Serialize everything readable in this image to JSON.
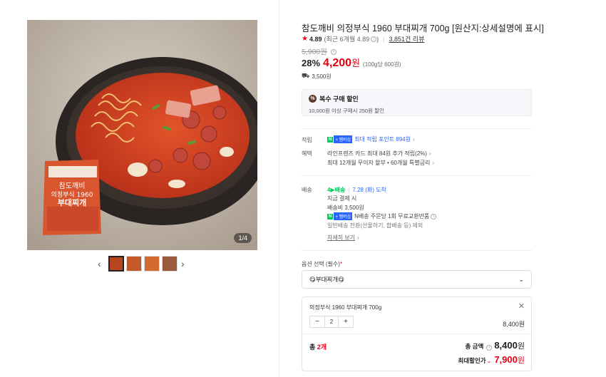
{
  "gallery": {
    "page_indicator": "1/4",
    "thumbnail_count": 4,
    "bag_text_line1": "참도깨비",
    "bag_text_line2": "의정부식 1960",
    "bag_text_line3": "부대찌개"
  },
  "product": {
    "title": "참도깨비 의정부식 1960 부대찌개 700g [원산지:상세설명에 표시]",
    "rating": "4.89",
    "rating_recent": "(최근 6개월 4.89",
    "rating_recent_close": ")",
    "review_link": "3,851건 리뷰",
    "original_price": "5,900원",
    "discount_rate": "28%",
    "price": "4,200",
    "price_unit": "원",
    "unit_price": "(100g당 600원)",
    "shipping_fee_top": "3,500원"
  },
  "coupon": {
    "icon": "%",
    "title": "복수 구매 할인",
    "desc": "10,000원 이상 구매시 250원 할인"
  },
  "benefits": {
    "label_point": "적립",
    "npay_n": "N",
    "npay_b": "+ 멤버십",
    "point_text": "최대 적립 포인트 894원",
    "label_benefit": "혜택",
    "card_text": "라인프렌즈 카드 최대 84원 추가 적립(2%)",
    "installment_text": "최대 12개월 무이자 할부 • 60개월 특별금리"
  },
  "delivery": {
    "label": "배송",
    "badge": "4▶배송",
    "arrival": "7.28 (화) 도착",
    "order_time": "지금 결제 시",
    "fee": "배송비 3,500원",
    "return_text": "N배송 주문당 1회 무료교환반품",
    "note": "일반배송 전환(선물하기, 합배송 등) 제외",
    "detail_link": "자세히 보기"
  },
  "options": {
    "label": "옵션 선택 (필수)",
    "required_mark": "*",
    "selected_value": "😋부대찌개😋"
  },
  "selection": {
    "name": "의정부식 1960 부대찌개 700g",
    "qty": "2",
    "price": "8,400원",
    "total_count_label": "총",
    "total_count": "2개",
    "total_label": "총 금액",
    "total_value": "8,400",
    "total_unit": "원",
    "max_disc_label": "최대할인가",
    "max_disc_value": "7,900",
    "max_disc_unit": "원"
  },
  "colors": {
    "accent_red": "#e60012",
    "link_blue": "#2b63ff",
    "npay_green": "#03c75a"
  }
}
